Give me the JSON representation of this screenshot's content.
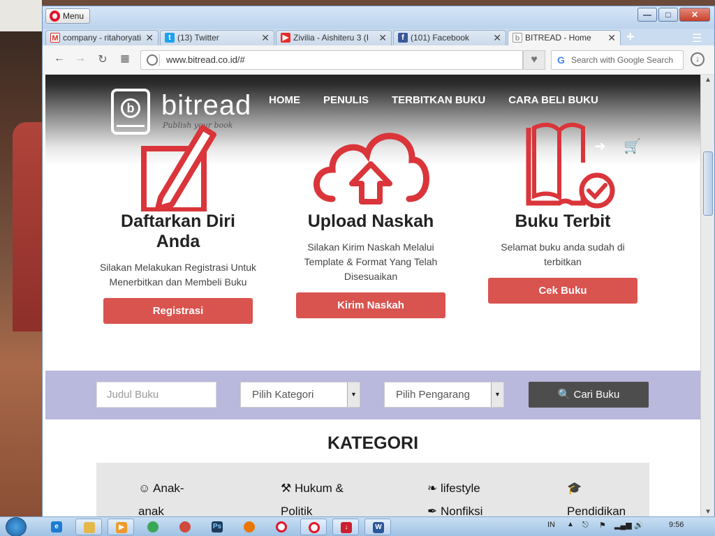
{
  "browser": {
    "menu_label": "Menu",
    "tabs": [
      {
        "title": "company - ritahoryati",
        "favicon": "gmail-icon",
        "color": "#d93025"
      },
      {
        "title": "(13) Twitter",
        "favicon": "twitter-icon",
        "color": "#1da1f2"
      },
      {
        "title": "Zivilia - Aishiteru 3 (I",
        "favicon": "youtube-icon",
        "color": "#e52d27"
      },
      {
        "title": "(101) Facebook",
        "favicon": "facebook-icon",
        "color": "#3b5998"
      },
      {
        "title": "BITREAD - Home",
        "favicon": "bitread-icon",
        "color": "#999999"
      }
    ],
    "url": "www.bitread.co.id/#",
    "search_placeholder": "Search with Google Search"
  },
  "site": {
    "logo_text": "bitread",
    "logo_tagline": "Publish your book",
    "nav": [
      "HOME",
      "PENULIS",
      "TERBITKAN BUKU",
      "CARA BELI BUKU"
    ],
    "features": [
      {
        "icon": "pencil-paper-icon",
        "title": "Daftarkan Diri Anda",
        "desc": "Silakan Melakukan Registrasi Untuk Menerbitkan dan Membeli Buku",
        "button": "Registrasi"
      },
      {
        "icon": "cloud-upload-icon",
        "title": "Upload Naskah",
        "desc": "Silakan Kirim Naskah Melalui Template & Format Yang Telah Disesuaikan",
        "button": "Kirim Naskah"
      },
      {
        "icon": "book-check-icon",
        "title": "Buku Terbit",
        "desc": "Selamat buku anda sudah di terbitkan",
        "button": "Cek Buku"
      }
    ],
    "search": {
      "title_placeholder": "Judul Buku",
      "category_select": "Pilih Kategori",
      "author_select": "Pilih Pengarang",
      "button": "Cari Buku"
    },
    "kategori_title": "KATEGORI",
    "categories": [
      {
        "label": "Anak-anak",
        "icon": "child-face-icon"
      },
      {
        "label": "Hukum & Politik",
        "icon": "gavel-icon"
      },
      {
        "label": "lifestyle",
        "icon": "leaf-icon"
      },
      {
        "label": "Nonfiksi",
        "icon": "quill-icon"
      },
      {
        "label": "Pendidikan",
        "icon": "graduation-cap-icon"
      }
    ],
    "accent_color": "#d9534f",
    "search_strip_color": "#b9b8dd"
  },
  "taskbar": {
    "language": "IN",
    "clock": "9:56"
  }
}
